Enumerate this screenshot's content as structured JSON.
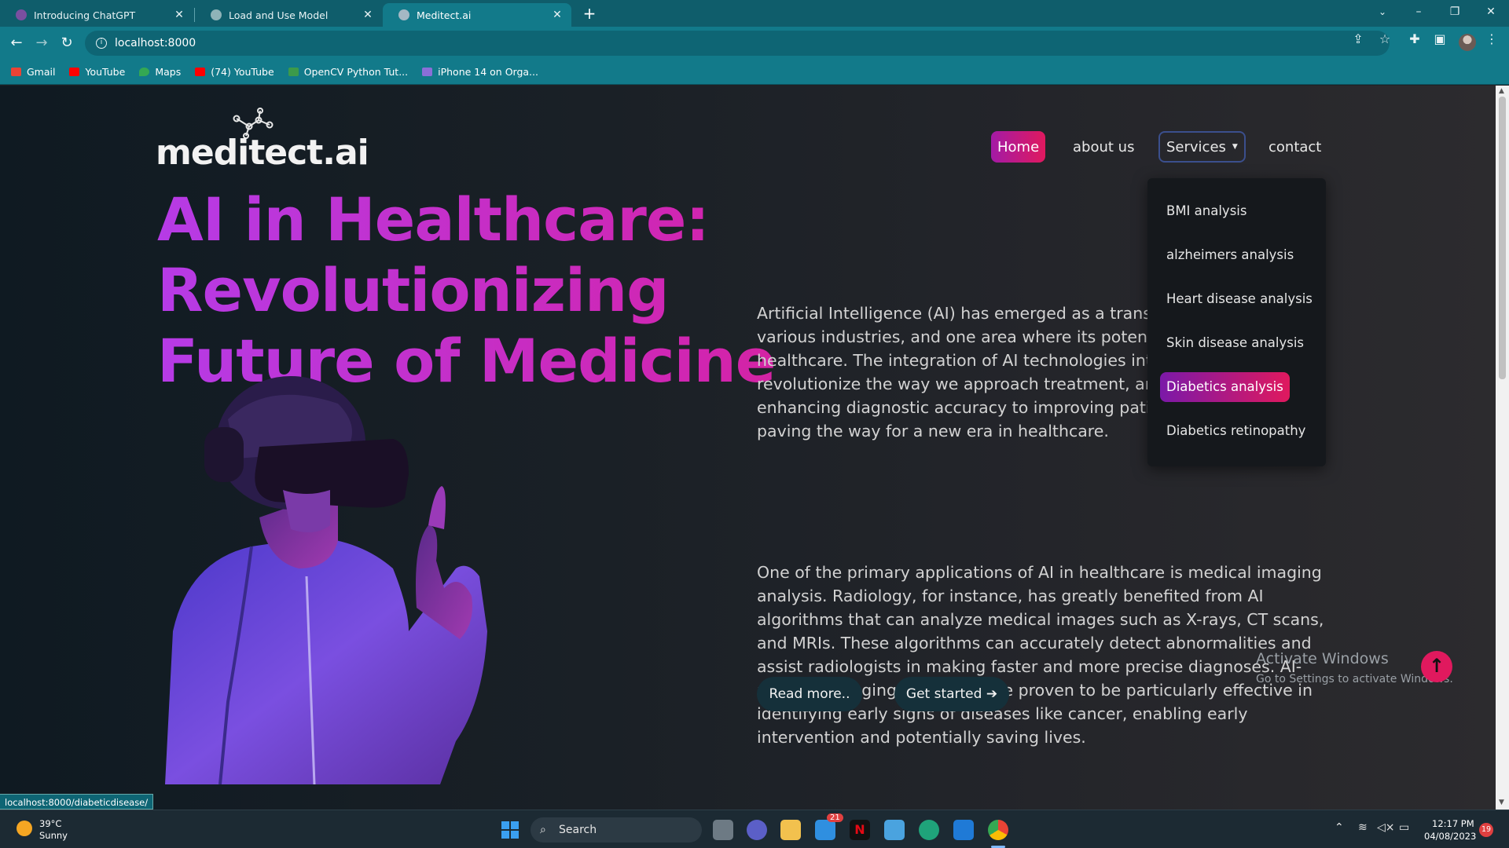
{
  "browser": {
    "tabs": [
      {
        "title": "Introducing ChatGPT",
        "favicon_color": "#7a4fa0"
      },
      {
        "title": "Load and Use Model",
        "favicon_color": "#8fb3b8"
      },
      {
        "title": "Meditect.ai",
        "favicon_color": "#a5b8c4"
      }
    ],
    "url": "localhost:8000",
    "bookmarks": [
      {
        "label": "Gmail",
        "color": "#ea4335"
      },
      {
        "label": "YouTube",
        "color": "#ff0000"
      },
      {
        "label": "Maps",
        "color": "#34a853"
      },
      {
        "label": "(74) YouTube",
        "color": "#ff0000"
      },
      {
        "label": "OpenCV Python Tut...",
        "color": "#3c9a4a"
      },
      {
        "label": "iPhone 14 on Orga...",
        "color": "#8a6fd8"
      }
    ]
  },
  "site": {
    "logo": "meditect.ai",
    "nav": {
      "home": "Home",
      "about": "about us",
      "services": "Services",
      "contact": "contact"
    },
    "services_menu": [
      "BMI analysis",
      "alzheimers analysis",
      "Heart disease analysis",
      "Skin disease analysis",
      "Diabetics analysis",
      "Diabetics retinopathy"
    ],
    "headline_line1": "AI in Healthcare: Revolutionizing",
    "headline_line2": "Future of Medicine",
    "para1": "Artificial Intelligence (AI) has emerged as a transformative force in various industries, and one area where its potential is particularly healthcare. The integration of AI technologies into has the potential to revolutionize the way we approach treatment, and patient care. From enhancing diagnostic accuracy to improving patient outcomes, AI is paving the way for a new era in healthcare.",
    "para2": "One of the primary applications of AI in healthcare is medical imaging analysis. Radiology, for instance, has greatly benefited from AI algorithms that can analyze medical images such as X-rays, CT scans, and MRIs. These algorithms can accurately detect abnormalities and assist radiologists in making faster and more precise diagnoses. AI-powered imaging systems have proven to be particularly effective in identifying early signs of diseases like cancer, enabling early intervention and potentially saving lives.",
    "read_more": "Read more..",
    "get_started": "Get started",
    "accent_gradient": [
      "#b63be6",
      "#e0195e"
    ]
  },
  "overlay": {
    "activate_title": "Activate Windows",
    "activate_sub": "Go to Settings to activate Windows.",
    "status_url": "localhost:8000/diabeticdisease/"
  },
  "taskbar": {
    "temp": "39°C",
    "condition": "Sunny",
    "search_placeholder": "Search",
    "mail_badge": "21",
    "time": "12:17 PM",
    "date": "04/08/2023",
    "notif_count": "19"
  }
}
